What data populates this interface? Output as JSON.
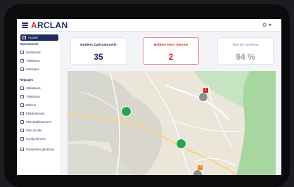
{
  "app": {
    "logo_lead": "≡",
    "logo_a": "A",
    "logo_rest": "RCLAN",
    "user_menu": "⚙ ▾"
  },
  "sidebar": {
    "items": [
      {
        "label": "Accueil",
        "active": true
      },
      {
        "label": "Opérationnel",
        "section": true
      },
      {
        "label": "Dashboard"
      },
      {
        "label": "Téléphone"
      },
      {
        "label": "Historique"
      },
      {
        "label": "Réglages",
        "section": true
      },
      {
        "label": "Utilisateurs"
      },
      {
        "label": "Téléphone"
      },
      {
        "label": "Boîtiers"
      },
      {
        "label": "Établissement"
      },
      {
        "label": "Plan Établissement"
      },
      {
        "label": "Plan de ville"
      },
      {
        "label": "Config Serveur"
      },
      {
        "label": "Paramètres généraux"
      }
    ]
  },
  "cards": [
    {
      "label": "Boîtiers Opérationnels",
      "value": "35",
      "color": "#1f2a5e"
    },
    {
      "label": "Boîtiers Hors Service",
      "value": "2",
      "color": "#d0272b"
    },
    {
      "label": "État du système",
      "value": "94 %",
      "color": "#9aa0b2"
    }
  ],
  "map": {
    "markers": [
      {
        "type": "ok",
        "color": "#2aa54b"
      },
      {
        "type": "ok",
        "color": "#2aa54b"
      },
      {
        "type": "alert",
        "color": "#8e8e93",
        "badge": "!",
        "badge_color": "#d0272b"
      },
      {
        "type": "warning",
        "color": "#8e8e93",
        "badge": "!",
        "badge_color": "#f08a24"
      }
    ]
  }
}
